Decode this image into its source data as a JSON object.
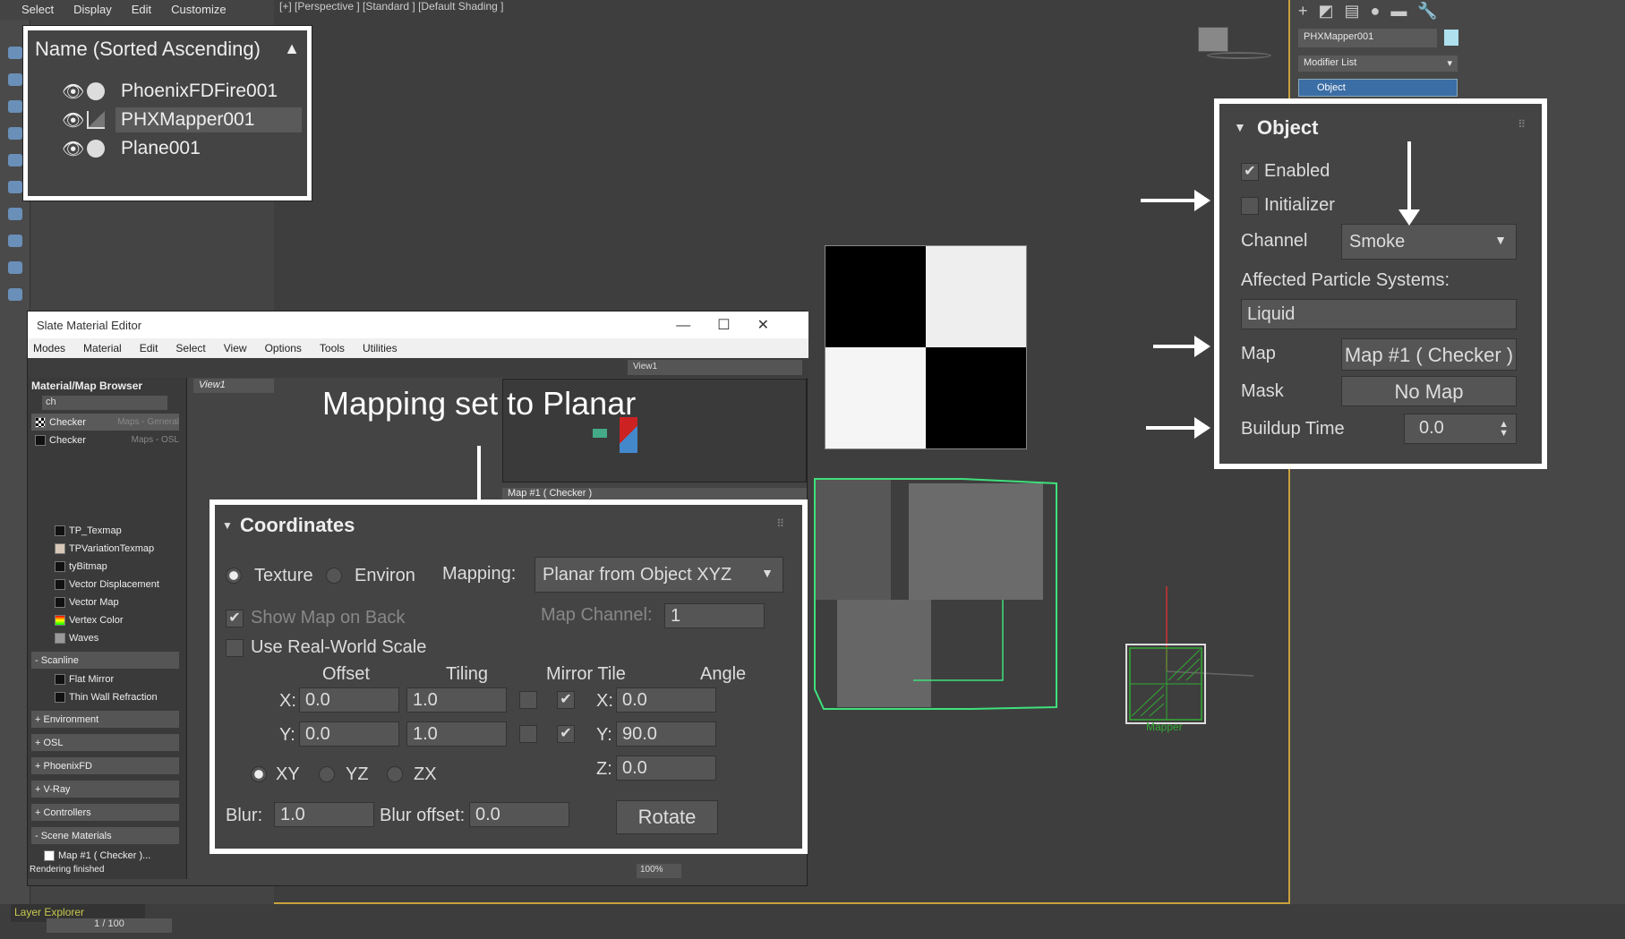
{
  "menu": [
    "Select",
    "Display",
    "Edit",
    "Customize"
  ],
  "viewport_label": "[+] [Perspective ] [Standard ] [Default Shading ]",
  "right_panel": {
    "object_name": "PHXMapper001",
    "modifier_list": "Modifier List",
    "modifier": "Object"
  },
  "explorer": {
    "header": "Name (Sorted Ascending)",
    "items": [
      "PhoenixFDFire001",
      "PHXMapper001",
      "Plane001"
    ],
    "selected": 1,
    "footer": "Layer Explorer",
    "frame": "1 / 100"
  },
  "slate": {
    "title": "Slate Material Editor",
    "menu": [
      "Modes",
      "Material",
      "Edit",
      "Select",
      "View",
      "Options",
      "Tools",
      "Utilities"
    ],
    "view_select": "View1",
    "view_tab": "View1",
    "browser_title": "Material/Map Browser",
    "search": "ch",
    "results": [
      {
        "name": "Checker",
        "cat": "Maps - General"
      },
      {
        "name": "Checker",
        "cat": "Maps - OSL"
      }
    ],
    "maps": [
      "TP_Texmap",
      "TPVariationTexmap",
      "tyBitmap",
      "Vector Displacement",
      "Vector Map",
      "Vertex Color",
      "Waves"
    ],
    "scanline_group": "- Scanline",
    "scanline": [
      "Flat Mirror",
      "Thin Wall Refraction"
    ],
    "groups": [
      "+ Environment",
      "+ OSL",
      "+ PhoenixFD",
      "+ V-Ray",
      "+ Controllers",
      "- Scene Materials"
    ],
    "scene_mat": "Map #1  ( Checker )...",
    "node_title": "Map #1  ( Checker )",
    "status": "Rendering finished",
    "zoom": "100%"
  },
  "caption": "Mapping set to Planar",
  "coordinates": {
    "title": "Coordinates",
    "texture": "Texture",
    "environ": "Environ",
    "mapping_label": "Mapping:",
    "mapping": "Planar from Object XYZ",
    "show_map": "Show Map on Back",
    "map_channel_label": "Map Channel:",
    "map_channel": "1",
    "real_world": "Use Real-World Scale",
    "offset": "Offset",
    "tiling": "Tiling",
    "mirror_tile": "Mirror Tile",
    "angle": "Angle",
    "x": "X:",
    "y": "Y:",
    "z": "Z:",
    "offset_x": "0.0",
    "offset_y": "0.0",
    "tiling_x": "1.0",
    "tiling_y": "1.0",
    "angle_x": "0.0",
    "angle_y": "90.0",
    "angle_z": "0.0",
    "xy": "XY",
    "yz": "YZ",
    "zx": "ZX",
    "blur_label": "Blur:",
    "blur": "1.0",
    "blur_offset_label": "Blur offset:",
    "blur_offset": "0.0",
    "rotate": "Rotate",
    "check": "✔"
  },
  "object": {
    "title": "Object",
    "enabled": "Enabled",
    "initializer": "Initializer",
    "channel_label": "Channel",
    "channel": "Smoke",
    "affected": "Affected Particle Systems:",
    "liquid": "Liquid",
    "map_label": "Map",
    "map": "Map #1  ( Checker )",
    "mask_label": "Mask",
    "mask": "No Map",
    "buildup_label": "Buildup Time",
    "buildup": "0.0",
    "check": "✔"
  },
  "mapper_label": "Mapper"
}
